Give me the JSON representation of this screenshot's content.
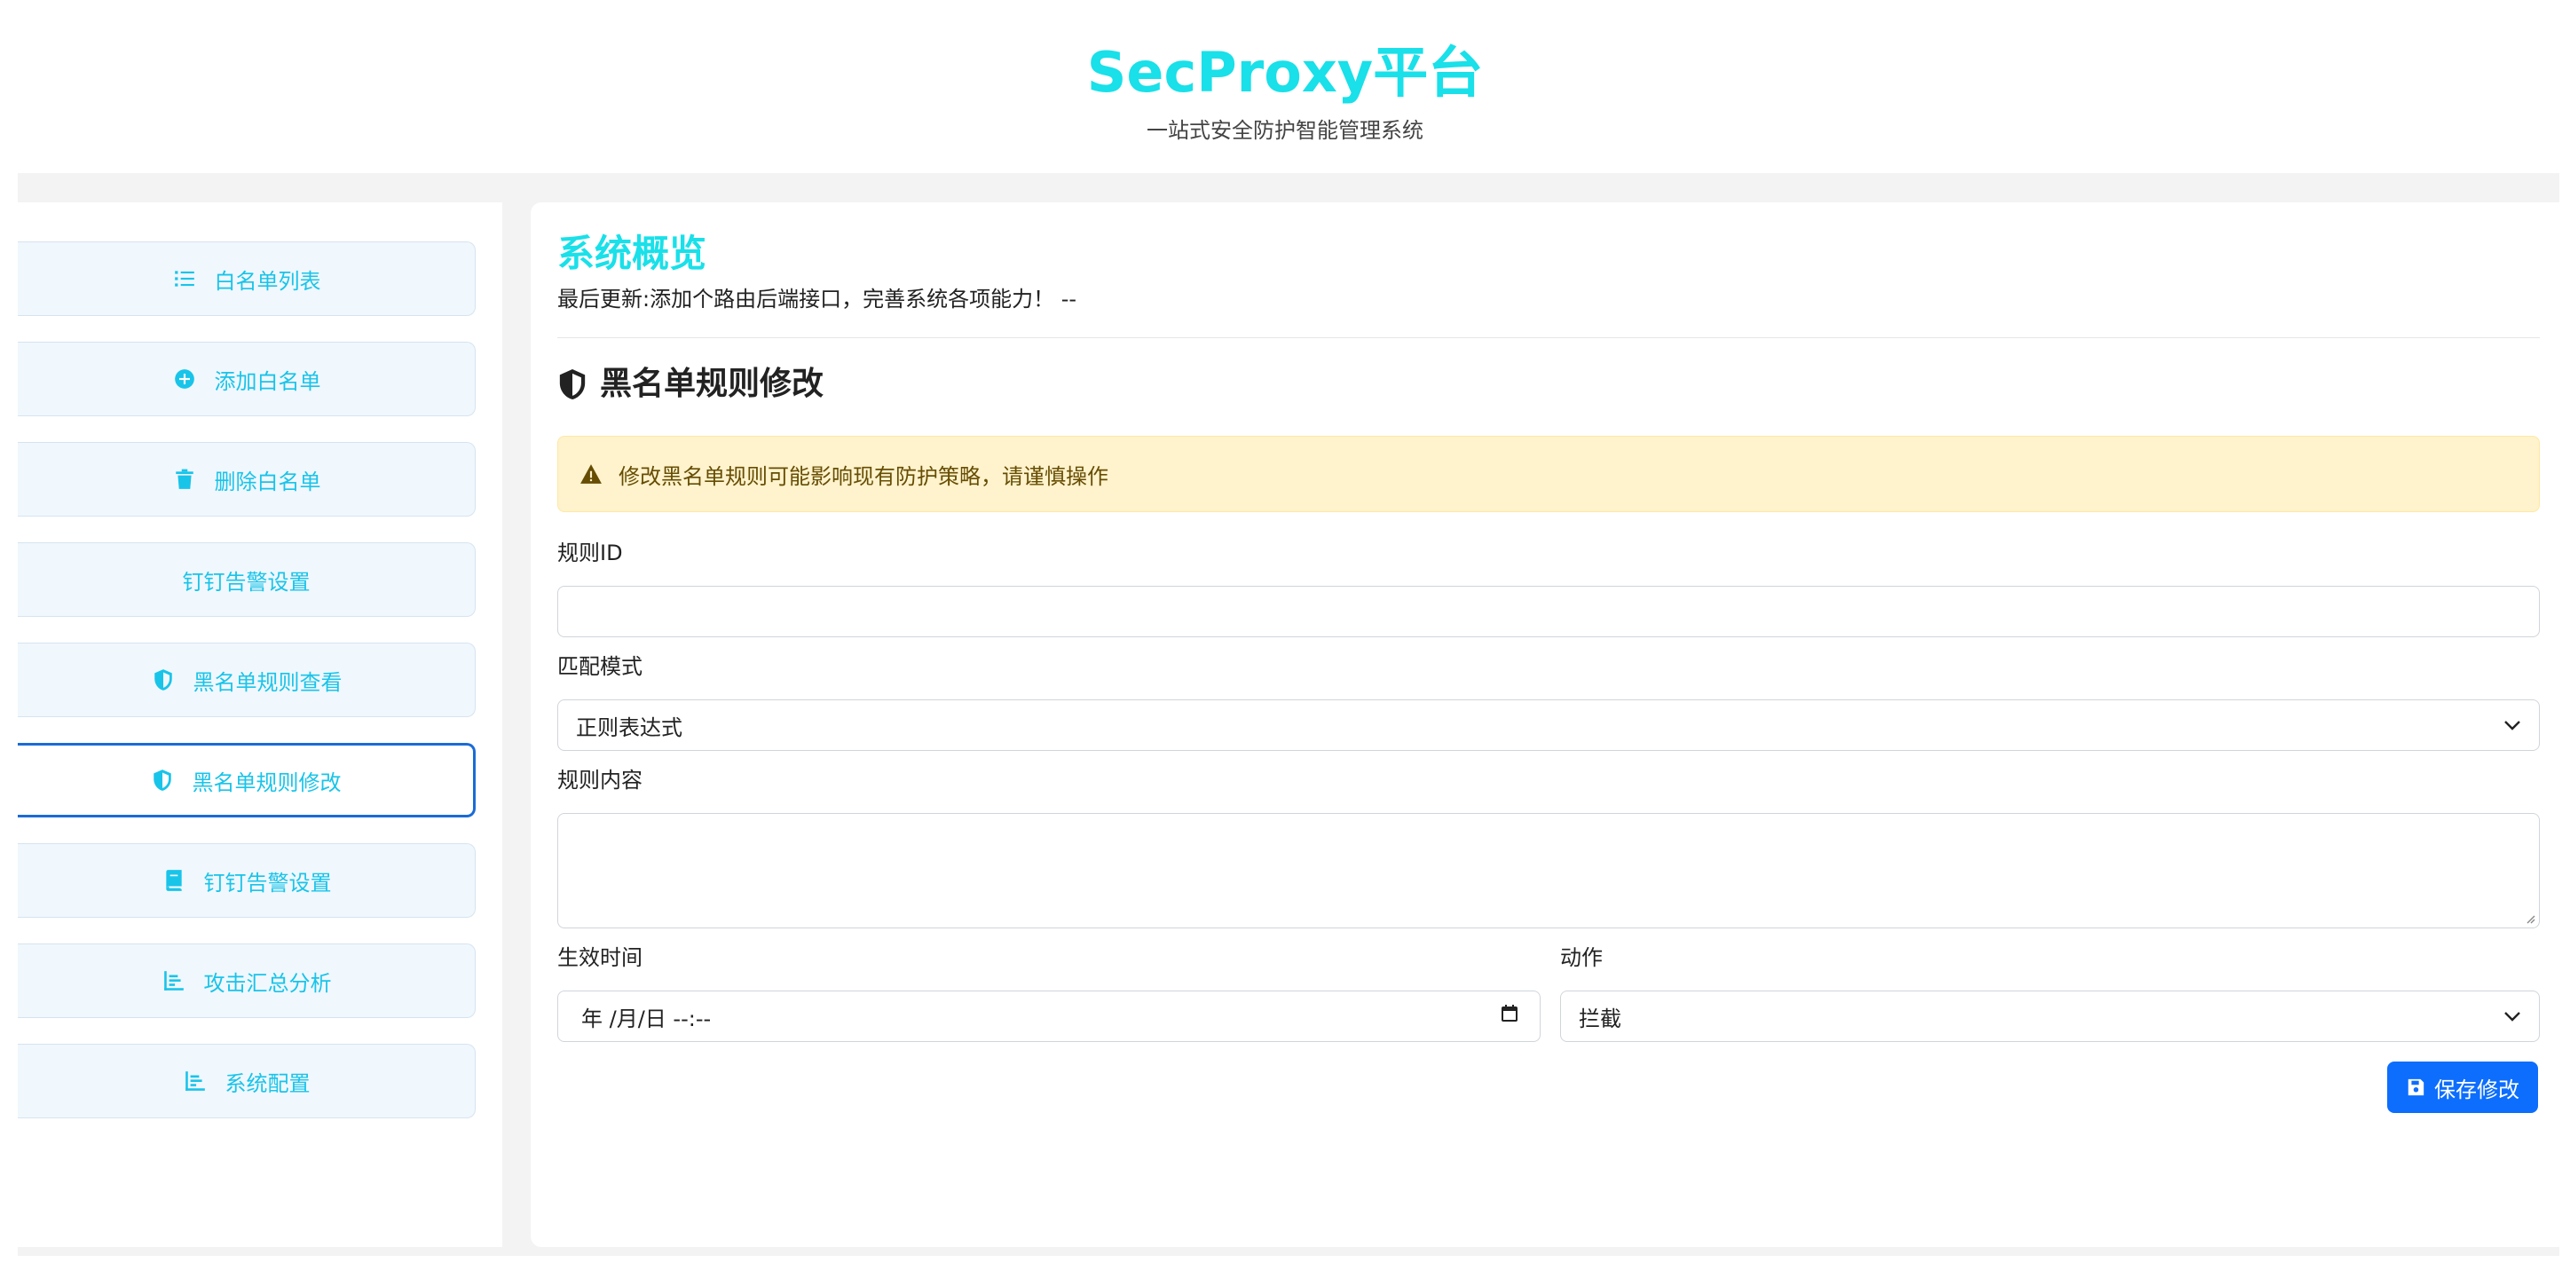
{
  "header": {
    "title": "SecProxy平台",
    "subtitle": "一站式安全防护智能管理系统"
  },
  "sidebar": {
    "items": [
      {
        "label": "白名单列表",
        "icon": "list-icon"
      },
      {
        "label": "添加白名单",
        "icon": "plus-circle-icon"
      },
      {
        "label": "删除白名单",
        "icon": "trash-icon"
      },
      {
        "label": "钉钉告警设置",
        "icon": ""
      },
      {
        "label": "黑名单规则查看",
        "icon": "shield-icon"
      },
      {
        "label": "黑名单规则修改",
        "icon": "shield-icon",
        "active": true
      },
      {
        "label": "钉钉告警设置",
        "icon": "book-icon"
      },
      {
        "label": "攻击汇总分析",
        "icon": "bar-chart-icon"
      },
      {
        "label": "系统配置",
        "icon": "bar-chart-icon"
      }
    ]
  },
  "main": {
    "title": "系统概览",
    "update_text": "最后更新:添加个路由后端接口，完善系统各项能力！ --",
    "section_title": "黑名单规则修改",
    "alert": "修改黑名单规则可能影响现有防护策略，请谨慎操作",
    "form": {
      "rule_id_label": "规则ID",
      "rule_id_value": "",
      "match_mode_label": "匹配模式",
      "match_mode_value": "正则表达式",
      "rule_content_label": "规则内容",
      "rule_content_value": "",
      "effective_time_label": "生效时间",
      "effective_time_value": "年 /月/日 --:--",
      "action_label": "动作",
      "action_value": "拦截",
      "save_label": "保存修改"
    }
  },
  "colors": {
    "brand": "#19e0e9",
    "sidebar_text": "#19c4e9",
    "active_border": "#1a6bd6",
    "primary_button": "#0d6efd",
    "alert_bg": "#fff3cd",
    "alert_text": "#664d03"
  }
}
